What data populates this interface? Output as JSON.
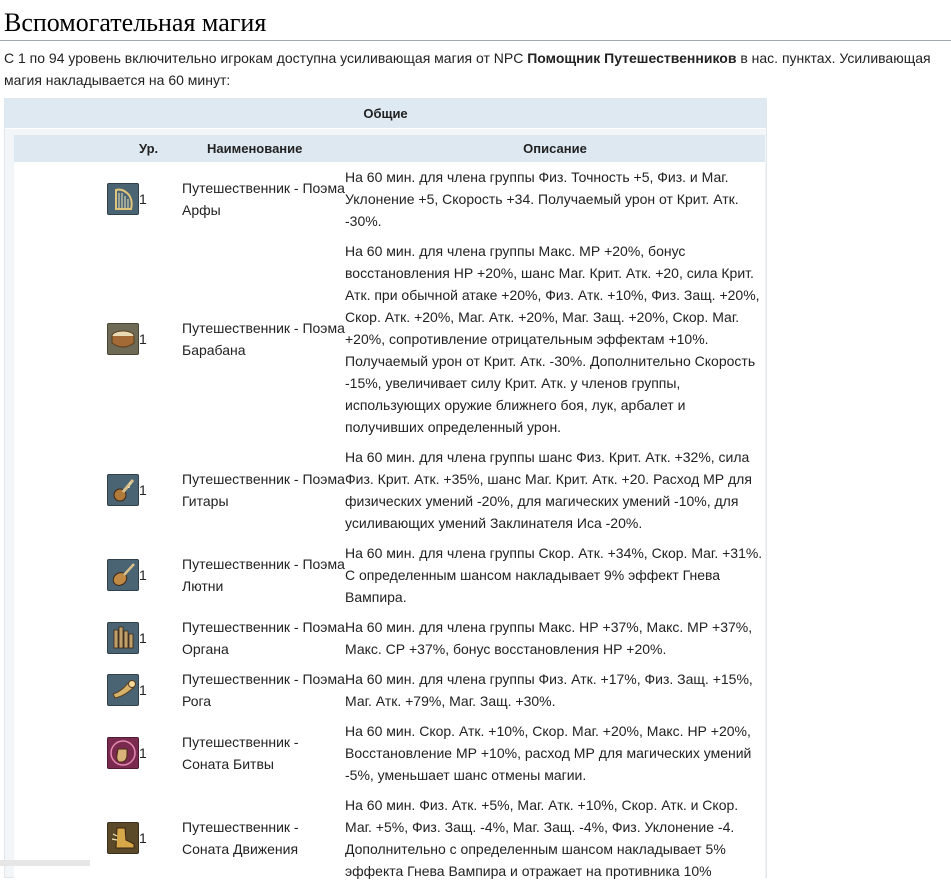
{
  "heading": "Вспомогательная магия",
  "intro": {
    "before": "С 1 по 94 уровень включительно игрокам доступна усиливающая магия от NPC ",
    "bold": "Помощник Путешественников",
    "after": " в нас. пунктах. Усиливающая магия накладывается на 60 минут:"
  },
  "panel": {
    "title": "Общие",
    "columns": {
      "level": "Ур.",
      "name": "Наименование",
      "desc": "Описание"
    }
  },
  "colors": {
    "table_header": "#dde8f0",
    "panel_bg": "#f3f6f9",
    "icon_music": "#4b6474",
    "icon_sonata": "#7a2a4e"
  },
  "skills": [
    {
      "icon": "harp-icon",
      "level": "1",
      "name": "Путешественник - Поэма Арфы",
      "desc": "На 60 мин. для члена группы Физ. Точность +5, Физ. и Маг. Уклонение +5, Скорость +34. Получаемый урон от Крит. Атк. -30%."
    },
    {
      "icon": "drum-icon",
      "level": "1",
      "name": "Путешественник - Поэма Барабана",
      "desc": "На 60 мин. для члена группы Макс. МР +20%, бонус восстановления НР +20%, шанс Маг. Крит. Атк. +20, сила Крит. Атк. при обычной атаке +20%, Физ. Атк. +10%, Физ. Защ. +20%, Скор. Атк. +20%, Маг. Атк. +20%, Маг. Защ. +20%, Скор. Маг. +20%, сопротивление отрицательным эффектам +10%. Получаемый урон от Крит. Атк. -30%. Дополнительно Скорость -15%, увеличивает силу Крит. Атк. у членов группы, использующих оружие ближнего боя, лук, арбалет и получивших определенный урон."
    },
    {
      "icon": "guitar-icon",
      "level": "1",
      "name": "Путешественник - Поэма Гитары",
      "desc": "На 60 мин. для члена группы шанс Физ. Крит. Атк. +32%, сила Физ. Крит. Атк. +35%, шанс Маг. Крит. Атк. +20. Расход МР для физических умений -20%, для магических умений -10%, для усиливающих умений Заклинателя Иса -20%."
    },
    {
      "icon": "lute-icon",
      "level": "1",
      "name": "Путешественник - Поэма Лютни",
      "desc": "На 60 мин. для члена группы Скор. Атк. +34%, Скор. Маг. +31%. С определенным шансом накладывает 9% эффект Гнева Вампира."
    },
    {
      "icon": "organ-icon",
      "level": "1",
      "name": "Путешественник - Поэма Органа",
      "desc": "На 60 мин. для члена группы Макс. НР +37%, Макс. МР +37%, Макс. СР +37%, бонус восстановления НР +20%."
    },
    {
      "icon": "horn-icon",
      "level": "1",
      "name": "Путешественник - Поэма Рога",
      "desc": "На 60 мин. для члена группы Физ. Атк. +17%, Физ. Защ. +15%, Маг. Атк. +79%, Маг. Защ. +30%."
    },
    {
      "icon": "fist-icon",
      "level": "1",
      "name": "Путешественник - Соната Битвы",
      "desc": "На 60 мин. Скор. Атк. +10%, Скор. Маг. +20%, Макс. НР +20%, Восстановление МР +10%, расход МР для магических умений -5%, уменьшает шанс отмены магии."
    },
    {
      "icon": "boot-icon",
      "level": "1",
      "name": "Путешественник - Соната Движения",
      "desc": "На 60 мин. Физ. Атк. +5%, Маг. Атк. +10%, Скор. Атк. и Скор. Маг. +5%, Физ. Защ. -4%, Маг. Защ. -4%, Физ. Уклонение -4. Дополнительно с определенным шансом накладывает 5% эффекта Гнева Вампира и отражает на противника 10%"
    }
  ]
}
